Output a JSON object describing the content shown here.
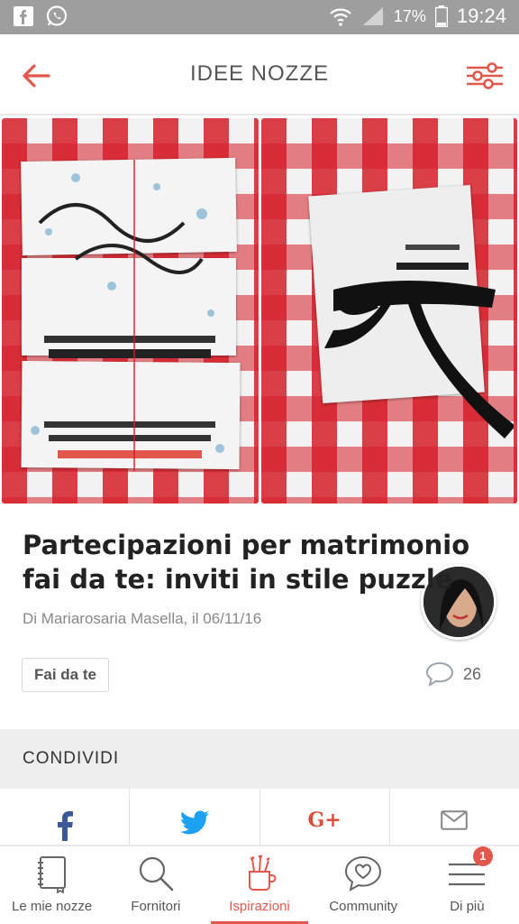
{
  "status_bar": {
    "battery_percent": "17%",
    "time": "19:24",
    "icons": [
      "facebook-icon",
      "whatsapp-icon",
      "wifi-icon",
      "signal-icon",
      "battery-icon"
    ]
  },
  "app_bar": {
    "title": "IDEE NOZZE",
    "back_icon": "back-arrow-icon",
    "filter_icon": "filter-sliders-icon"
  },
  "article": {
    "title": "Partecipazioni per matrimonio fai da te: inviti in stile puzzle",
    "byline": "Di Mariarosaria Masella, il 06/11/16",
    "tag": "Fai da te",
    "comment_count": "26"
  },
  "share": {
    "label": "CONDIVIDI",
    "buttons": [
      {
        "name": "facebook",
        "glyph": "f",
        "color": "#3b5998"
      },
      {
        "name": "twitter",
        "glyph": "twitter-bird",
        "color": "#1da1f2"
      },
      {
        "name": "google-plus",
        "glyph": "G+",
        "color": "#dd4b39"
      },
      {
        "name": "email",
        "glyph": "envelope",
        "color": "#888888"
      }
    ]
  },
  "bottom_nav": {
    "items": [
      {
        "label": "Le mie nozze",
        "icon": "notebook-icon"
      },
      {
        "label": "Fornitori",
        "icon": "search-icon"
      },
      {
        "label": "Ispirazioni",
        "icon": "brush-cup-icon",
        "active": true
      },
      {
        "label": "Community",
        "icon": "chat-heart-icon"
      },
      {
        "label": "Di più",
        "icon": "menu-icon",
        "badge": "1"
      }
    ]
  },
  "colors": {
    "accent": "#e2574c",
    "status_bar": "#9e9e9e",
    "share_header": "#eeeeee"
  }
}
